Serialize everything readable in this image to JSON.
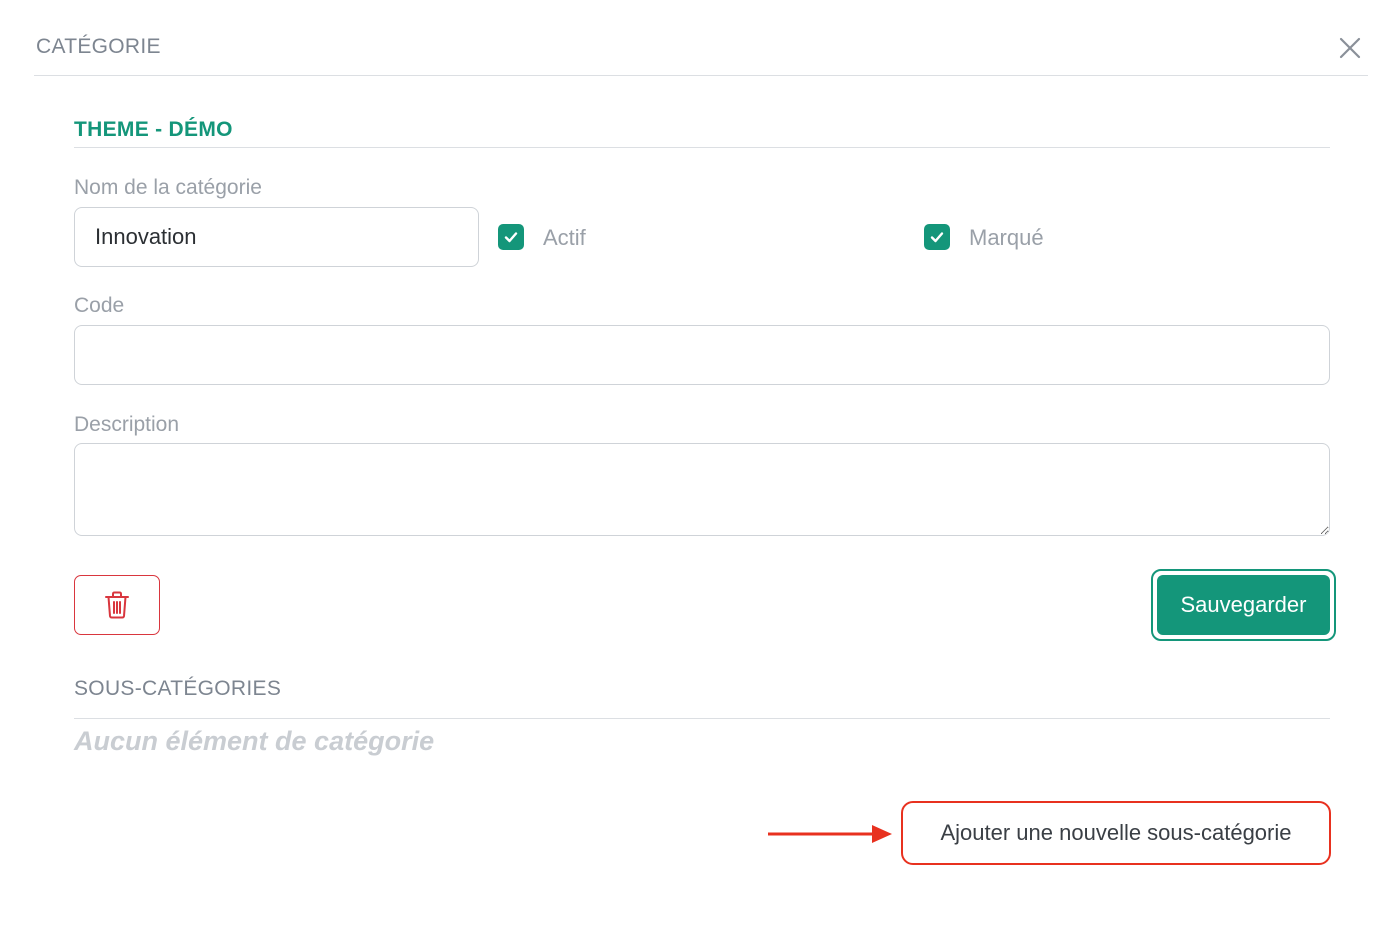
{
  "header": {
    "title": "CATÉGORIE"
  },
  "section": {
    "title": "THEME - DÉMO"
  },
  "form": {
    "name_label": "Nom de la catégorie",
    "name_value": "Innovation",
    "active_label": "Actif",
    "active_checked": true,
    "marked_label": "Marqué",
    "marked_checked": true,
    "code_label": "Code",
    "code_value": "",
    "description_label": "Description",
    "description_value": ""
  },
  "actions": {
    "save_label": "Sauvegarder"
  },
  "subcategories": {
    "title": "SOUS-CATÉGORIES",
    "empty_text": "Aucun élément de catégorie",
    "add_label": "Ajouter une nouvelle sous-catégorie"
  },
  "colors": {
    "accent": "#14967a",
    "danger": "#d9363e",
    "highlight": "#e8311f"
  },
  "icons": {
    "close": "close-icon",
    "checkbox": "check-icon",
    "delete": "trash-icon",
    "annotation": "arrow-right-icon"
  }
}
